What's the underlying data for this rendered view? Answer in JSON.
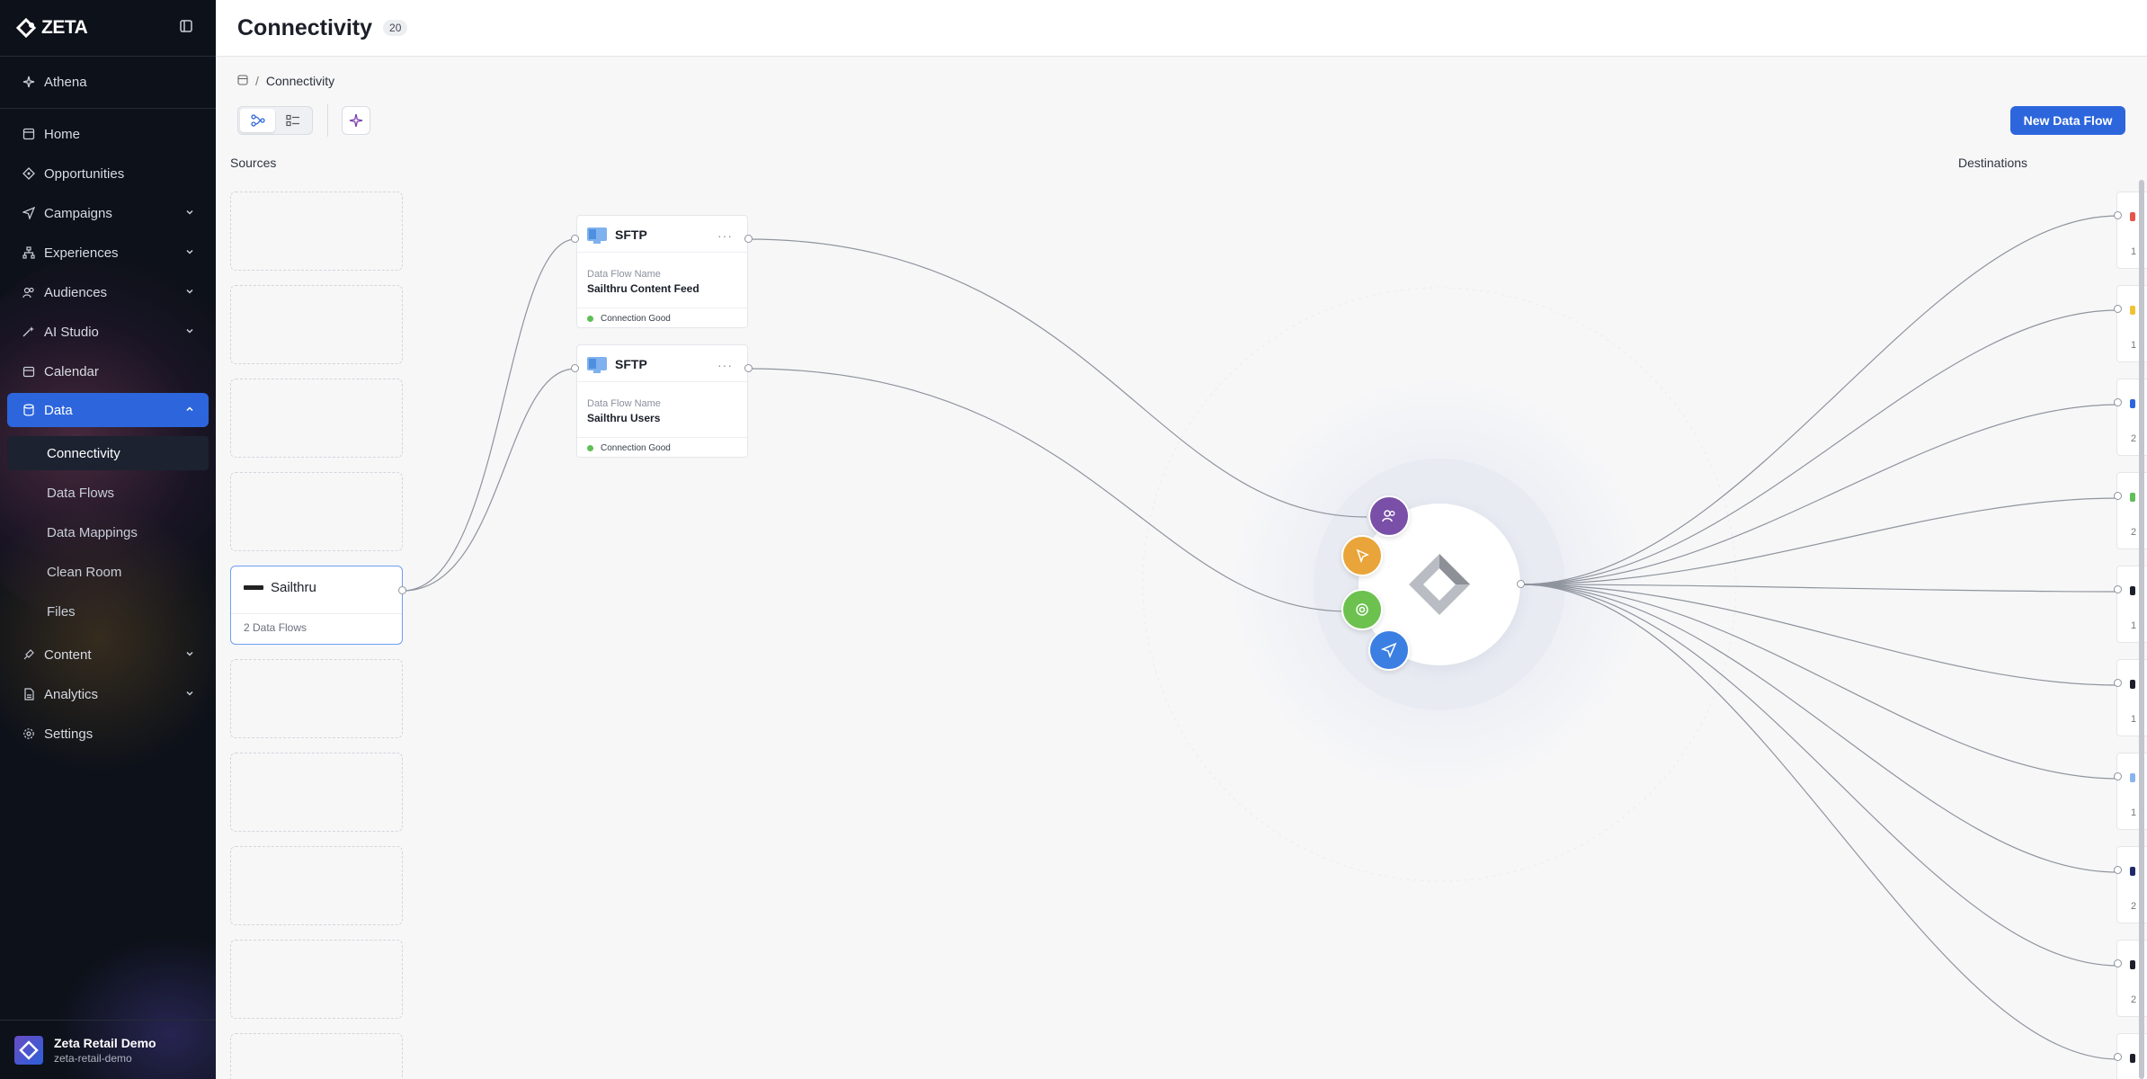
{
  "app": {
    "brand": "ZETA"
  },
  "sidebar": {
    "athena": "Athena",
    "items": [
      {
        "label": "Home"
      },
      {
        "label": "Opportunities"
      },
      {
        "label": "Campaigns"
      },
      {
        "label": "Experiences"
      },
      {
        "label": "Audiences"
      },
      {
        "label": "AI Studio"
      },
      {
        "label": "Calendar"
      },
      {
        "label": "Data"
      },
      {
        "label": "Content"
      },
      {
        "label": "Analytics"
      },
      {
        "label": "Settings"
      }
    ],
    "data_sub": [
      {
        "label": "Connectivity"
      },
      {
        "label": "Data Flows"
      },
      {
        "label": "Data Mappings"
      },
      {
        "label": "Clean Room"
      },
      {
        "label": "Files"
      }
    ],
    "account": {
      "name": "Zeta Retail Demo",
      "handle": "zeta-retail-demo"
    }
  },
  "header": {
    "title": "Connectivity",
    "count": "20"
  },
  "breadcrumb": {
    "sep": "/",
    "current": "Connectivity"
  },
  "toolbar": {
    "new_flow": "New Data Flow"
  },
  "columns": {
    "sources": "Sources",
    "destinations": "Destinations"
  },
  "source": {
    "name": "Sailthru",
    "flows": "2 Data Flows"
  },
  "flows": [
    {
      "type": "SFTP",
      "more": "···",
      "label": "Data Flow Name",
      "name": "Sailthru Content Feed",
      "status": "Connection Good"
    },
    {
      "type": "SFTP",
      "more": "···",
      "label": "Data Flow Name",
      "name": "Sailthru Users",
      "status": "Connection Good"
    }
  ],
  "destinations": [
    {
      "color": "#e8534a",
      "num": "1"
    },
    {
      "color": "#f0c233",
      "num": "1"
    },
    {
      "color": "#2d66dc",
      "num": "2"
    },
    {
      "color": "#5fbf58",
      "num": "2"
    },
    {
      "color": "#1b1f29",
      "num": "1"
    },
    {
      "color": "#1b1f29",
      "num": "1"
    },
    {
      "color": "#8ab4f0",
      "num": "1"
    },
    {
      "color": "#1f2a6b",
      "num": "2"
    },
    {
      "color": "#1b1f29",
      "num": "2"
    },
    {
      "color": "#1b1f29",
      "num": ""
    }
  ],
  "colors": {
    "accent": "#2d66dc",
    "hub_purple": "#7a4fa8",
    "hub_orange": "#e9a53a",
    "hub_green": "#6cc14f",
    "hub_blue": "#3b7fe3"
  }
}
